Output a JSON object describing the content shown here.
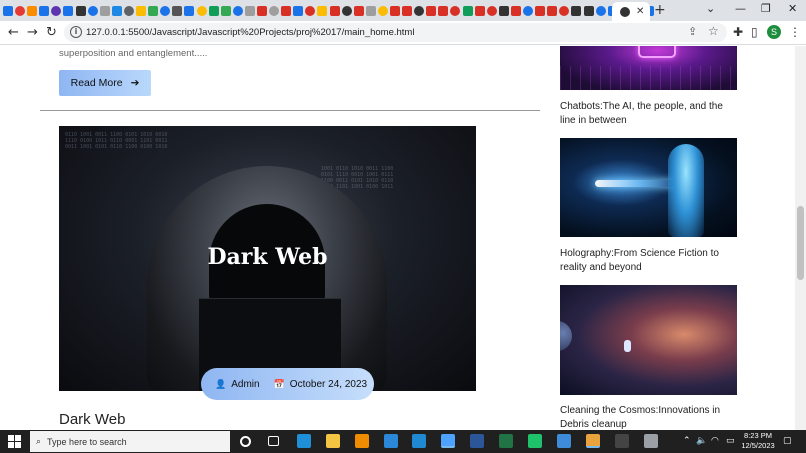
{
  "browser": {
    "tab_icon_colors": [
      "#1a73e8",
      "#e53935",
      "#fb8c00",
      "#1a73e8",
      "#5e35b1",
      "#1a73e8",
      "#333333",
      "#1a73e8",
      "#9e9e9e",
      "#1e88e5",
      "#5f6368",
      "#fbbc04",
      "#34a853",
      "#1a73e8",
      "#555555",
      "#1a73e8",
      "#fbbc04",
      "#0f9d58",
      "#34a853",
      "#1a73e8",
      "#9e9e9e",
      "#d93025",
      "#9e9e9e",
      "#d93025",
      "#1a73e8",
      "#d93025",
      "#fbbc04",
      "#d93025",
      "#333333",
      "#d93025",
      "#9e9e9e",
      "#fbbc04",
      "#d93025",
      "#d93025",
      "#333333",
      "#d93025",
      "#d93025",
      "#d93025",
      "#0f9d58",
      "#d93025",
      "#d93025",
      "#333333",
      "#d93025",
      "#1a73e8",
      "#d93025",
      "#d93025",
      "#d93025",
      "#333333",
      "#333333",
      "#1a73e8",
      "#1a73e8",
      "#d93025",
      "#333333",
      "#1a73e8"
    ],
    "active_tab_close": "✕",
    "new_tab": "+",
    "window_controls": [
      "⌄",
      "—",
      "❐",
      "✕"
    ],
    "url": "127.0.0.1:5500/Javascript/Javascript%20Projects/proj%2017/main_home.html",
    "profile_initial": "S",
    "nav": {
      "back": "←",
      "forward": "→",
      "reload": "↻"
    }
  },
  "page": {
    "previous_excerpt": "superposition and entanglement.....",
    "read_more": {
      "label": "Read More",
      "arrow": "➔"
    },
    "post": {
      "image_title": "Dark Web",
      "author": "Admin",
      "date": "October 24, 2023",
      "title": "Dark Web"
    },
    "sidebar": [
      {
        "caption": "Chatbots:The AI, the people, and the line in between"
      },
      {
        "caption": "Holography:From Science Fiction to reality and beyond"
      },
      {
        "caption": "Cleaning the Cosmos:Innovations in Debris cleanup"
      }
    ]
  },
  "taskbar": {
    "search_placeholder": "Type here to search",
    "apps": [
      {
        "name": "cortana",
        "color": "#ffffff"
      },
      {
        "name": "task-view",
        "color": "#ffffff"
      },
      {
        "name": "edge",
        "color": "#1e90d8"
      },
      {
        "name": "file-explorer",
        "color": "#f4c542"
      },
      {
        "name": "calendar",
        "color": "#f08c00"
      },
      {
        "name": "mail",
        "color": "#2b88d8"
      },
      {
        "name": "vscode",
        "color": "#1f8ad2"
      },
      {
        "name": "photos",
        "color": "#4da3ff"
      },
      {
        "name": "word",
        "color": "#2b579a"
      },
      {
        "name": "excel",
        "color": "#217346"
      },
      {
        "name": "pycharm",
        "color": "#1fc16b"
      },
      {
        "name": "powerpoint-video",
        "color": "#3d8bd9"
      },
      {
        "name": "chrome",
        "color": "#e8a33d"
      },
      {
        "name": "terminal",
        "color": "#444444"
      },
      {
        "name": "settings",
        "color": "#9aa0a6"
      }
    ],
    "time": "8:23 PM",
    "date": "12/5/2023"
  }
}
